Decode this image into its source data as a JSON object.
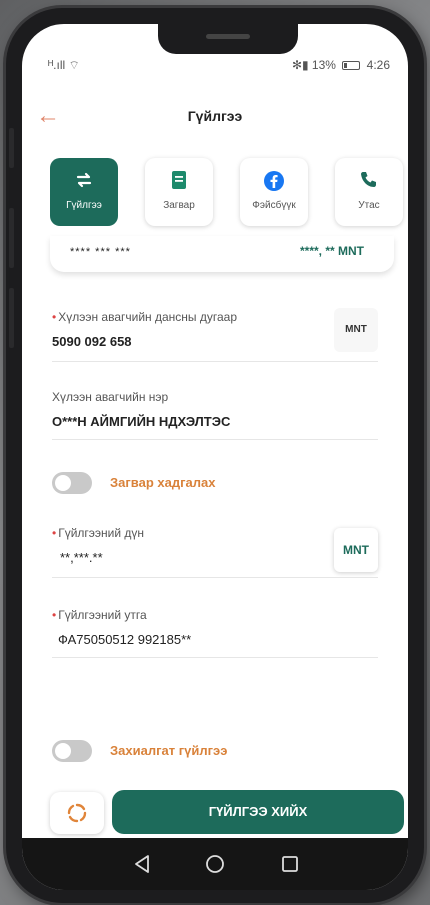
{
  "status_bar": {
    "left": "ᴴ.ıll ⌔",
    "battery_percent": "✻▮ 13%",
    "time": "4:26"
  },
  "header": {
    "title": "Гүйлгээ"
  },
  "tabs": [
    {
      "label": "Гүйлгээ",
      "icon": "arrows-swap-icon"
    },
    {
      "label": "Загвар",
      "icon": "template-book-icon"
    },
    {
      "label": "Фэйсбүүк",
      "icon": "facebook-icon"
    },
    {
      "label": "Утас",
      "icon": "phone-icon"
    }
  ],
  "account_card": {
    "account_number": "**** *** ***",
    "balance": "****, **  MNT"
  },
  "form": {
    "receiver_account": {
      "label": "Хүлээн авагчийн дансны дугаар",
      "value": "5090 092 658",
      "currency": "MNT"
    },
    "receiver_name": {
      "label": "Хүлээн авагчийн нэр",
      "value": "О***Н АЙМГИЙН НДХЭЛТЭС"
    },
    "save_template_label": "Загвар хадгалах",
    "amount": {
      "label": "Гүйлгээний дүн",
      "value": "**,***.**",
      "currency": "MNT"
    },
    "description": {
      "label": "Гүйлгээний утга",
      "value": "ФА75050512   992185**"
    },
    "scheduled_label": "Захиалгат гүйлгээ"
  },
  "actions": {
    "submit_label": "ГҮЙЛГЭЭ ХИЙХ"
  },
  "colors": {
    "primary": "#1d6b5b",
    "accent_orange": "#d9823a",
    "back_arrow": "#e0856a"
  }
}
